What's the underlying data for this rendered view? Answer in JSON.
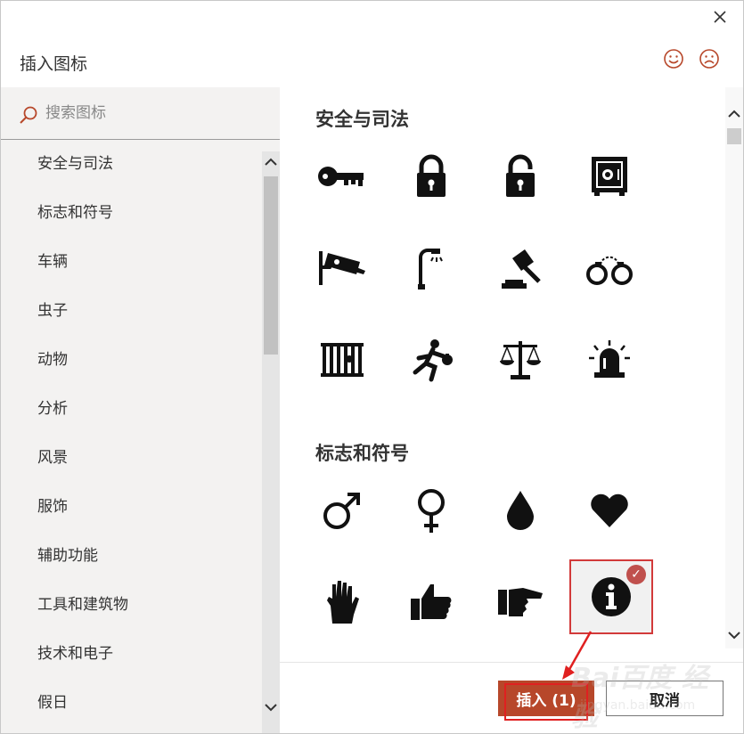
{
  "dialog": {
    "title": "插入图标",
    "close_icon": "close-icon",
    "feedback_icons": [
      "smile-icon",
      "frown-icon"
    ]
  },
  "search": {
    "placeholder": "搜索图标"
  },
  "categories": [
    "安全与司法",
    "标志和符号",
    "车辆",
    "虫子",
    "动物",
    "分析",
    "风景",
    "服饰",
    "辅助功能",
    "工具和建筑物",
    "技术和电子",
    "假日"
  ],
  "sections": [
    {
      "title": "安全与司法",
      "icons": [
        "key-icon",
        "lock-closed-icon",
        "lock-open-icon",
        "safe-icon",
        "security-camera-icon",
        "street-lamp-icon",
        "gavel-icon",
        "handcuffs-icon",
        "jail-icon",
        "thief-running-icon",
        "scales-of-justice-icon",
        "siren-icon"
      ]
    },
    {
      "title": "标志和符号",
      "icons": [
        "male-symbol-icon",
        "female-symbol-icon",
        "water-drop-icon",
        "heart-icon",
        "raised-hand-icon",
        "thumbs-up-icon",
        "pointing-hand-icon",
        "info-icon"
      ]
    }
  ],
  "selected_icon": "info-icon",
  "selected_check": "✓",
  "footer": {
    "insert_label": "插入 (1)",
    "cancel_label": "取消"
  },
  "watermark": {
    "line1": "Bai百度 经验",
    "line2": "jingyan.baidu.com"
  },
  "colors": {
    "accent": "#b7472a",
    "highlight": "#e02020",
    "check": "#c0504d"
  }
}
